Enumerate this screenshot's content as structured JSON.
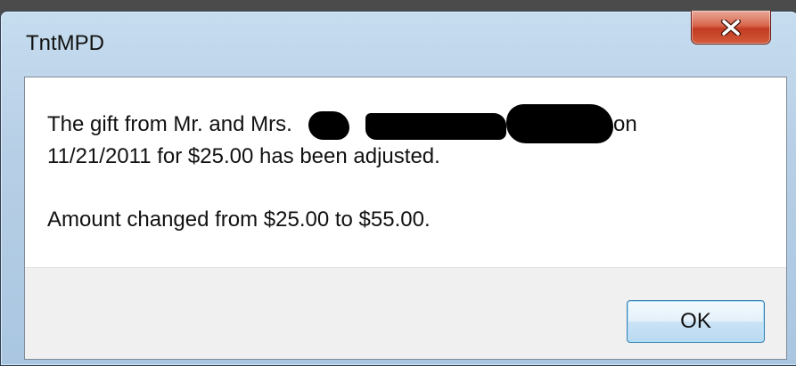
{
  "window": {
    "title": "TntMPD"
  },
  "message": {
    "line1_prefix": "The gift from Mr. and Mrs.",
    "line1_suffix": "on",
    "line2": "11/21/2011 for $25.00 has been adjusted.",
    "line3": "Amount changed from $25.00 to $55.00."
  },
  "buttons": {
    "ok_label": "OK",
    "close_icon": "close-x-icon"
  },
  "colors": {
    "close_button": "#c23b22",
    "ok_button_border": "#3c7fb1",
    "title_bar": "#b7cfe6",
    "content_background": "#ffffff",
    "footer_background": "#f0f0f0"
  }
}
